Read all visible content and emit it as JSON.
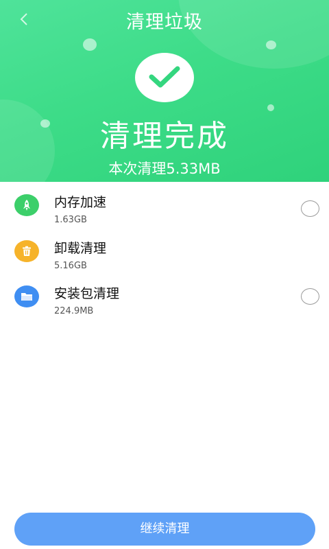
{
  "header": {
    "title": "清理垃圾",
    "status": "清理完成",
    "summary": "本次清理5.33MB"
  },
  "items": [
    {
      "name": "内存加速",
      "size": "1.63GB",
      "icon": "rocket-icon",
      "color": "#3ccf6a",
      "has_radio": true
    },
    {
      "name": "卸载清理",
      "size": "5.16GB",
      "icon": "trash-icon",
      "color": "#f6b32a",
      "has_radio": false
    },
    {
      "name": "安装包清理",
      "size": "224.9MB",
      "icon": "folder-icon",
      "color": "#3f8ef2",
      "has_radio": true
    }
  ],
  "footer": {
    "button_label": "继续清理"
  },
  "colors": {
    "header_green": "#3ddc88",
    "button_blue": "#5fa1f7"
  }
}
